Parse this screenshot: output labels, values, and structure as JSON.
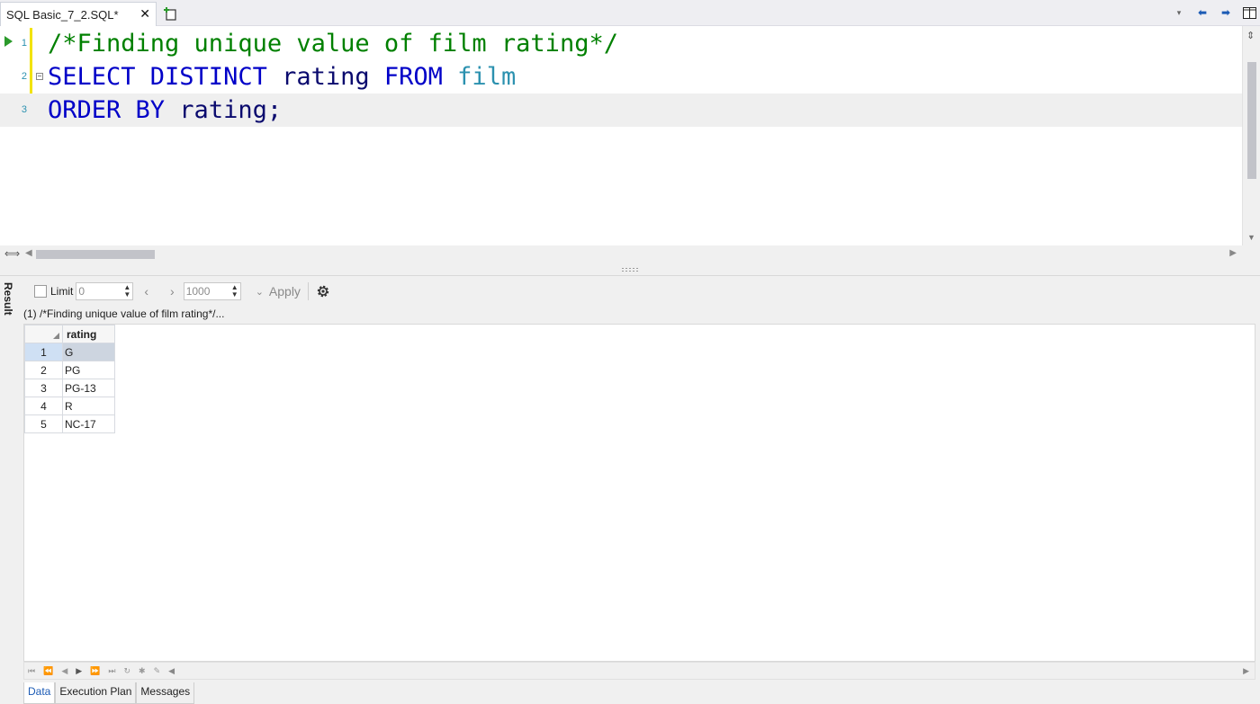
{
  "tab": {
    "title": "SQL Basic_7_2.SQL*",
    "close": "✕"
  },
  "editor": {
    "lines": [
      {
        "num": "1",
        "comment": "/*Finding unique value of film rating*/"
      },
      {
        "num": "2",
        "kw1": "SELECT DISTINCT",
        "ident": " rating ",
        "kw2": "FROM",
        "table": " film"
      },
      {
        "num": "3",
        "kw1": "ORDER BY",
        "ident": " rating;"
      }
    ]
  },
  "result": {
    "side_label": "Result",
    "toolbar": {
      "limit_label": "Limit",
      "limit_value": "0",
      "page_size": "1000",
      "apply_label": "Apply"
    },
    "query_caption": "(1) /*Finding unique value of film rating*/...",
    "grid": {
      "column": "rating",
      "rows": [
        {
          "n": "1",
          "v": "G"
        },
        {
          "n": "2",
          "v": "PG"
        },
        {
          "n": "3",
          "v": "PG-13"
        },
        {
          "n": "4",
          "v": "R"
        },
        {
          "n": "5",
          "v": "NC-17"
        }
      ]
    },
    "bottom_tabs": [
      "Data",
      "Execution Plan",
      "Messages"
    ]
  },
  "colors": {
    "keyword": "#0000c8",
    "comment": "#008000",
    "table": "#2b91af",
    "accent": "#1c5bb5",
    "change_bar": "#f2e300"
  }
}
